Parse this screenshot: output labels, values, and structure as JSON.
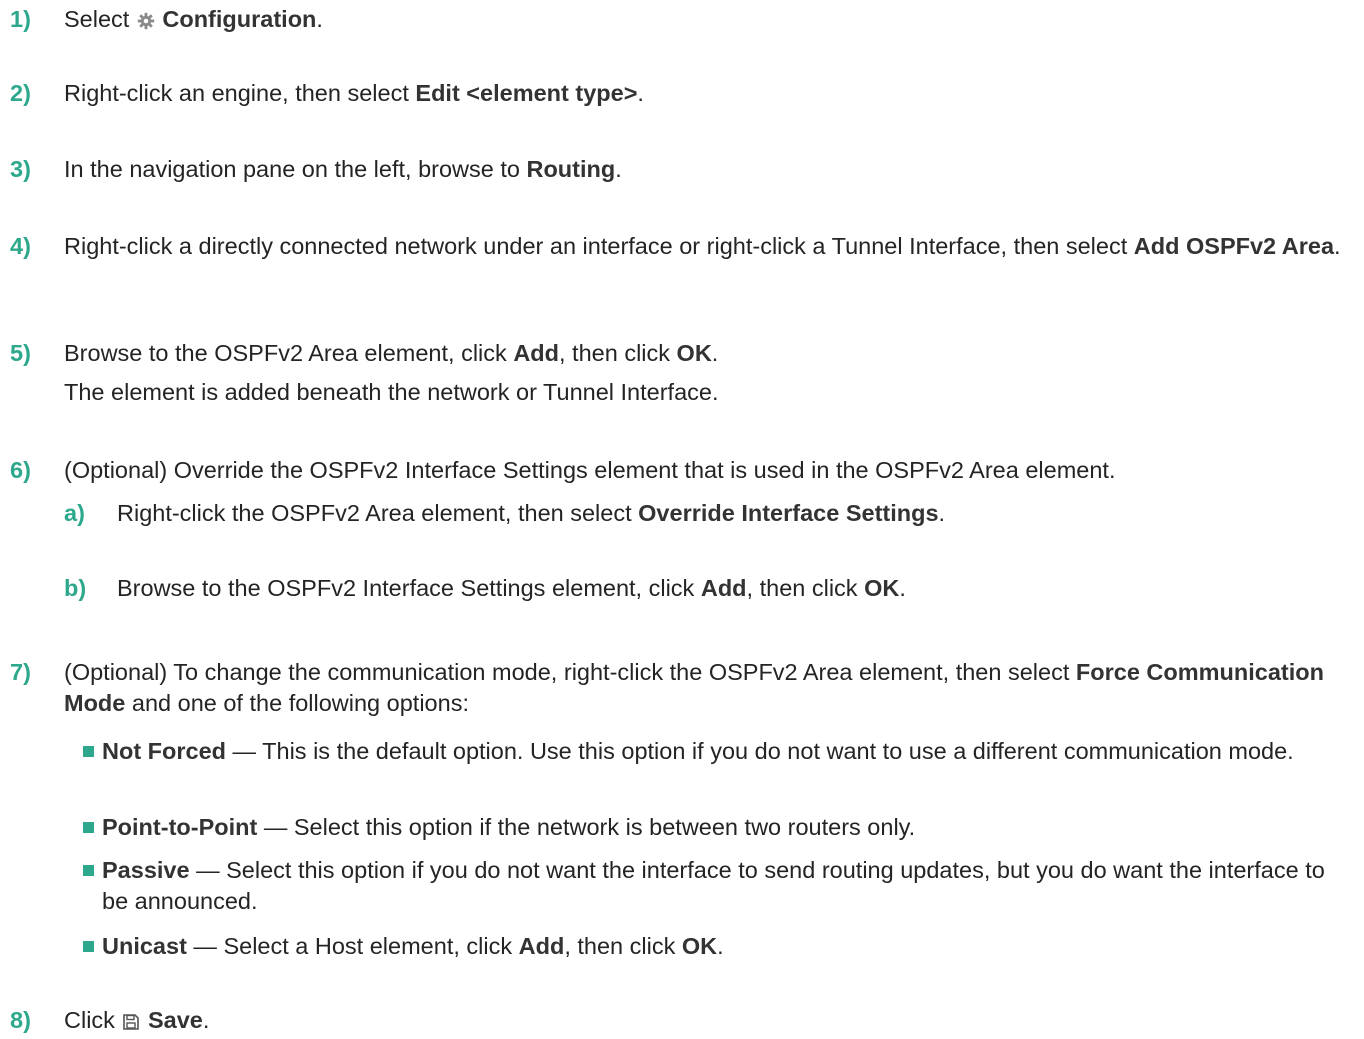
{
  "steps": [
    {
      "num": "1)",
      "pre": "Select ",
      "icon": "gear-icon",
      "bold": "Configuration",
      "post": "."
    },
    {
      "num": "2)",
      "pre": "Right-click an engine, then select ",
      "bold": "Edit <element type>",
      "post": "."
    },
    {
      "num": "3)",
      "pre": "In the navigation pane on the left, browse to ",
      "bold": "Routing",
      "post": "."
    },
    {
      "num": "4)",
      "pre": "Right-click a directly connected network under an interface or right-click a Tunnel Interface, then select ",
      "bold": "Add OSPFv2 Area",
      "post": "."
    },
    {
      "num": "5)",
      "pre": "Browse to the OSPFv2 Area element, click ",
      "bold": "Add",
      "mid": ", then click ",
      "bold2": "OK",
      "post": ".",
      "result": "The element is added beneath the network or Tunnel Interface."
    },
    {
      "num": "6)",
      "text": "(Optional) Override the OSPFv2 Interface Settings element that is used in the OSPFv2 Area element.",
      "substeps": [
        {
          "num": "a)",
          "pre": "Right-click the OSPFv2 Area element, then select ",
          "bold": "Override Interface Settings",
          "post": "."
        },
        {
          "num": "b)",
          "pre": "Browse to the OSPFv2 Interface Settings element, click ",
          "bold": "Add",
          "mid": ", then click ",
          "bold2": "OK",
          "post": "."
        }
      ]
    },
    {
      "num": "7)",
      "pre": "(Optional) To change the communication mode, right-click the OSPFv2 Area element, then select ",
      "bold": "Force Communication Mode",
      "post": " and one of the following options:",
      "options": [
        {
          "bold": "Not Forced",
          "text": " — This is the default option. Use this option if you do not want to use a different communication mode."
        },
        {
          "bold": "Point-to-Point",
          "text": " — Select this option if the network is between two routers only."
        },
        {
          "bold": "Passive",
          "text": " — Select this option if you do not want the interface to send routing updates, but you do want the interface to be announced."
        },
        {
          "bold": "Unicast",
          "pre": " — Select a Host element, click ",
          "bold2": "Add",
          "mid": ", then click ",
          "bold3": "OK",
          "post": "."
        }
      ]
    },
    {
      "num": "8)",
      "pre": "Click ",
      "icon": "save-icon",
      "bold": "Save",
      "post": "."
    }
  ],
  "colors": {
    "accent": "#2ea88c",
    "text": "#242424"
  }
}
